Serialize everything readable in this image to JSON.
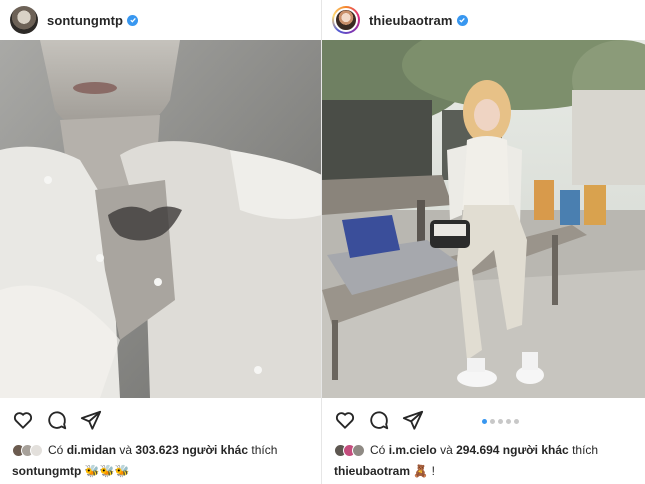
{
  "left_post": {
    "username": "sontungmtp",
    "verified": true,
    "likes": {
      "prefix": "Có",
      "first_liker": "di.midan",
      "connector": "và",
      "count_text": "303.623 người khác",
      "suffix": "thích"
    },
    "caption": {
      "username": "sontungmtp",
      "text": "🐝🐝🐝"
    }
  },
  "right_post": {
    "username": "thieubaotram",
    "verified": true,
    "likes": {
      "prefix": "Có",
      "first_liker": "i.m.cielo",
      "connector": "và",
      "count_text": "294.694 người khác",
      "suffix": "thích"
    },
    "caption": {
      "username": "thieubaotram",
      "text": "🧸 !"
    },
    "carousel": {
      "total": 5,
      "active_index": 0
    }
  },
  "icons": [
    "heart-icon",
    "comment-icon",
    "share-icon",
    "verified-badge-icon"
  ],
  "colors": {
    "verified_blue": "#3897f0",
    "text": "#262626",
    "carousel_active": "#3897f0"
  }
}
